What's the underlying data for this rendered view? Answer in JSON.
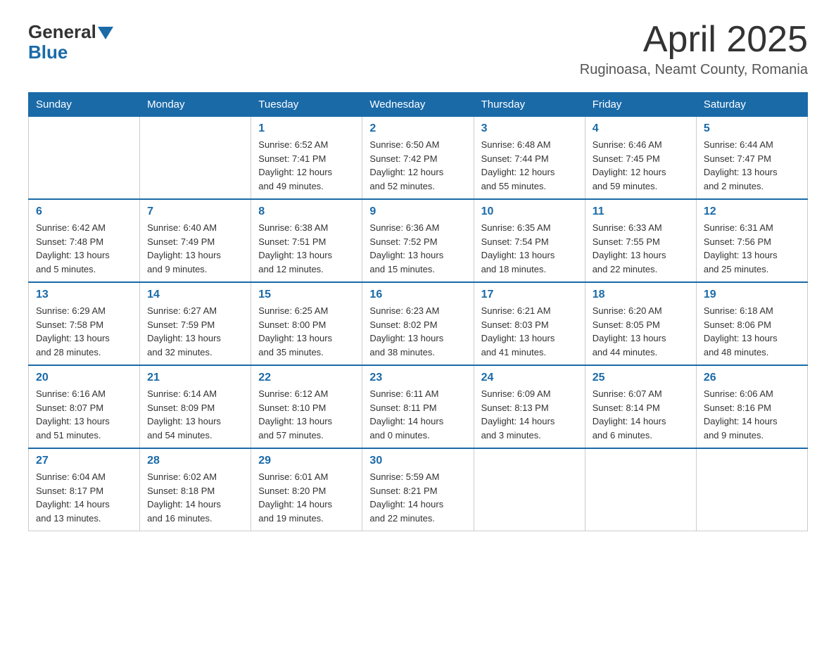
{
  "header": {
    "logo_general": "General",
    "logo_blue": "Blue",
    "month_title": "April 2025",
    "location": "Ruginoasa, Neamt County, Romania"
  },
  "calendar": {
    "days_of_week": [
      "Sunday",
      "Monday",
      "Tuesday",
      "Wednesday",
      "Thursday",
      "Friday",
      "Saturday"
    ],
    "weeks": [
      [
        {
          "day": "",
          "info": ""
        },
        {
          "day": "",
          "info": ""
        },
        {
          "day": "1",
          "info": "Sunrise: 6:52 AM\nSunset: 7:41 PM\nDaylight: 12 hours\nand 49 minutes."
        },
        {
          "day": "2",
          "info": "Sunrise: 6:50 AM\nSunset: 7:42 PM\nDaylight: 12 hours\nand 52 minutes."
        },
        {
          "day": "3",
          "info": "Sunrise: 6:48 AM\nSunset: 7:44 PM\nDaylight: 12 hours\nand 55 minutes."
        },
        {
          "day": "4",
          "info": "Sunrise: 6:46 AM\nSunset: 7:45 PM\nDaylight: 12 hours\nand 59 minutes."
        },
        {
          "day": "5",
          "info": "Sunrise: 6:44 AM\nSunset: 7:47 PM\nDaylight: 13 hours\nand 2 minutes."
        }
      ],
      [
        {
          "day": "6",
          "info": "Sunrise: 6:42 AM\nSunset: 7:48 PM\nDaylight: 13 hours\nand 5 minutes."
        },
        {
          "day": "7",
          "info": "Sunrise: 6:40 AM\nSunset: 7:49 PM\nDaylight: 13 hours\nand 9 minutes."
        },
        {
          "day": "8",
          "info": "Sunrise: 6:38 AM\nSunset: 7:51 PM\nDaylight: 13 hours\nand 12 minutes."
        },
        {
          "day": "9",
          "info": "Sunrise: 6:36 AM\nSunset: 7:52 PM\nDaylight: 13 hours\nand 15 minutes."
        },
        {
          "day": "10",
          "info": "Sunrise: 6:35 AM\nSunset: 7:54 PM\nDaylight: 13 hours\nand 18 minutes."
        },
        {
          "day": "11",
          "info": "Sunrise: 6:33 AM\nSunset: 7:55 PM\nDaylight: 13 hours\nand 22 minutes."
        },
        {
          "day": "12",
          "info": "Sunrise: 6:31 AM\nSunset: 7:56 PM\nDaylight: 13 hours\nand 25 minutes."
        }
      ],
      [
        {
          "day": "13",
          "info": "Sunrise: 6:29 AM\nSunset: 7:58 PM\nDaylight: 13 hours\nand 28 minutes."
        },
        {
          "day": "14",
          "info": "Sunrise: 6:27 AM\nSunset: 7:59 PM\nDaylight: 13 hours\nand 32 minutes."
        },
        {
          "day": "15",
          "info": "Sunrise: 6:25 AM\nSunset: 8:00 PM\nDaylight: 13 hours\nand 35 minutes."
        },
        {
          "day": "16",
          "info": "Sunrise: 6:23 AM\nSunset: 8:02 PM\nDaylight: 13 hours\nand 38 minutes."
        },
        {
          "day": "17",
          "info": "Sunrise: 6:21 AM\nSunset: 8:03 PM\nDaylight: 13 hours\nand 41 minutes."
        },
        {
          "day": "18",
          "info": "Sunrise: 6:20 AM\nSunset: 8:05 PM\nDaylight: 13 hours\nand 44 minutes."
        },
        {
          "day": "19",
          "info": "Sunrise: 6:18 AM\nSunset: 8:06 PM\nDaylight: 13 hours\nand 48 minutes."
        }
      ],
      [
        {
          "day": "20",
          "info": "Sunrise: 6:16 AM\nSunset: 8:07 PM\nDaylight: 13 hours\nand 51 minutes."
        },
        {
          "day": "21",
          "info": "Sunrise: 6:14 AM\nSunset: 8:09 PM\nDaylight: 13 hours\nand 54 minutes."
        },
        {
          "day": "22",
          "info": "Sunrise: 6:12 AM\nSunset: 8:10 PM\nDaylight: 13 hours\nand 57 minutes."
        },
        {
          "day": "23",
          "info": "Sunrise: 6:11 AM\nSunset: 8:11 PM\nDaylight: 14 hours\nand 0 minutes."
        },
        {
          "day": "24",
          "info": "Sunrise: 6:09 AM\nSunset: 8:13 PM\nDaylight: 14 hours\nand 3 minutes."
        },
        {
          "day": "25",
          "info": "Sunrise: 6:07 AM\nSunset: 8:14 PM\nDaylight: 14 hours\nand 6 minutes."
        },
        {
          "day": "26",
          "info": "Sunrise: 6:06 AM\nSunset: 8:16 PM\nDaylight: 14 hours\nand 9 minutes."
        }
      ],
      [
        {
          "day": "27",
          "info": "Sunrise: 6:04 AM\nSunset: 8:17 PM\nDaylight: 14 hours\nand 13 minutes."
        },
        {
          "day": "28",
          "info": "Sunrise: 6:02 AM\nSunset: 8:18 PM\nDaylight: 14 hours\nand 16 minutes."
        },
        {
          "day": "29",
          "info": "Sunrise: 6:01 AM\nSunset: 8:20 PM\nDaylight: 14 hours\nand 19 minutes."
        },
        {
          "day": "30",
          "info": "Sunrise: 5:59 AM\nSunset: 8:21 PM\nDaylight: 14 hours\nand 22 minutes."
        },
        {
          "day": "",
          "info": ""
        },
        {
          "day": "",
          "info": ""
        },
        {
          "day": "",
          "info": ""
        }
      ]
    ]
  }
}
